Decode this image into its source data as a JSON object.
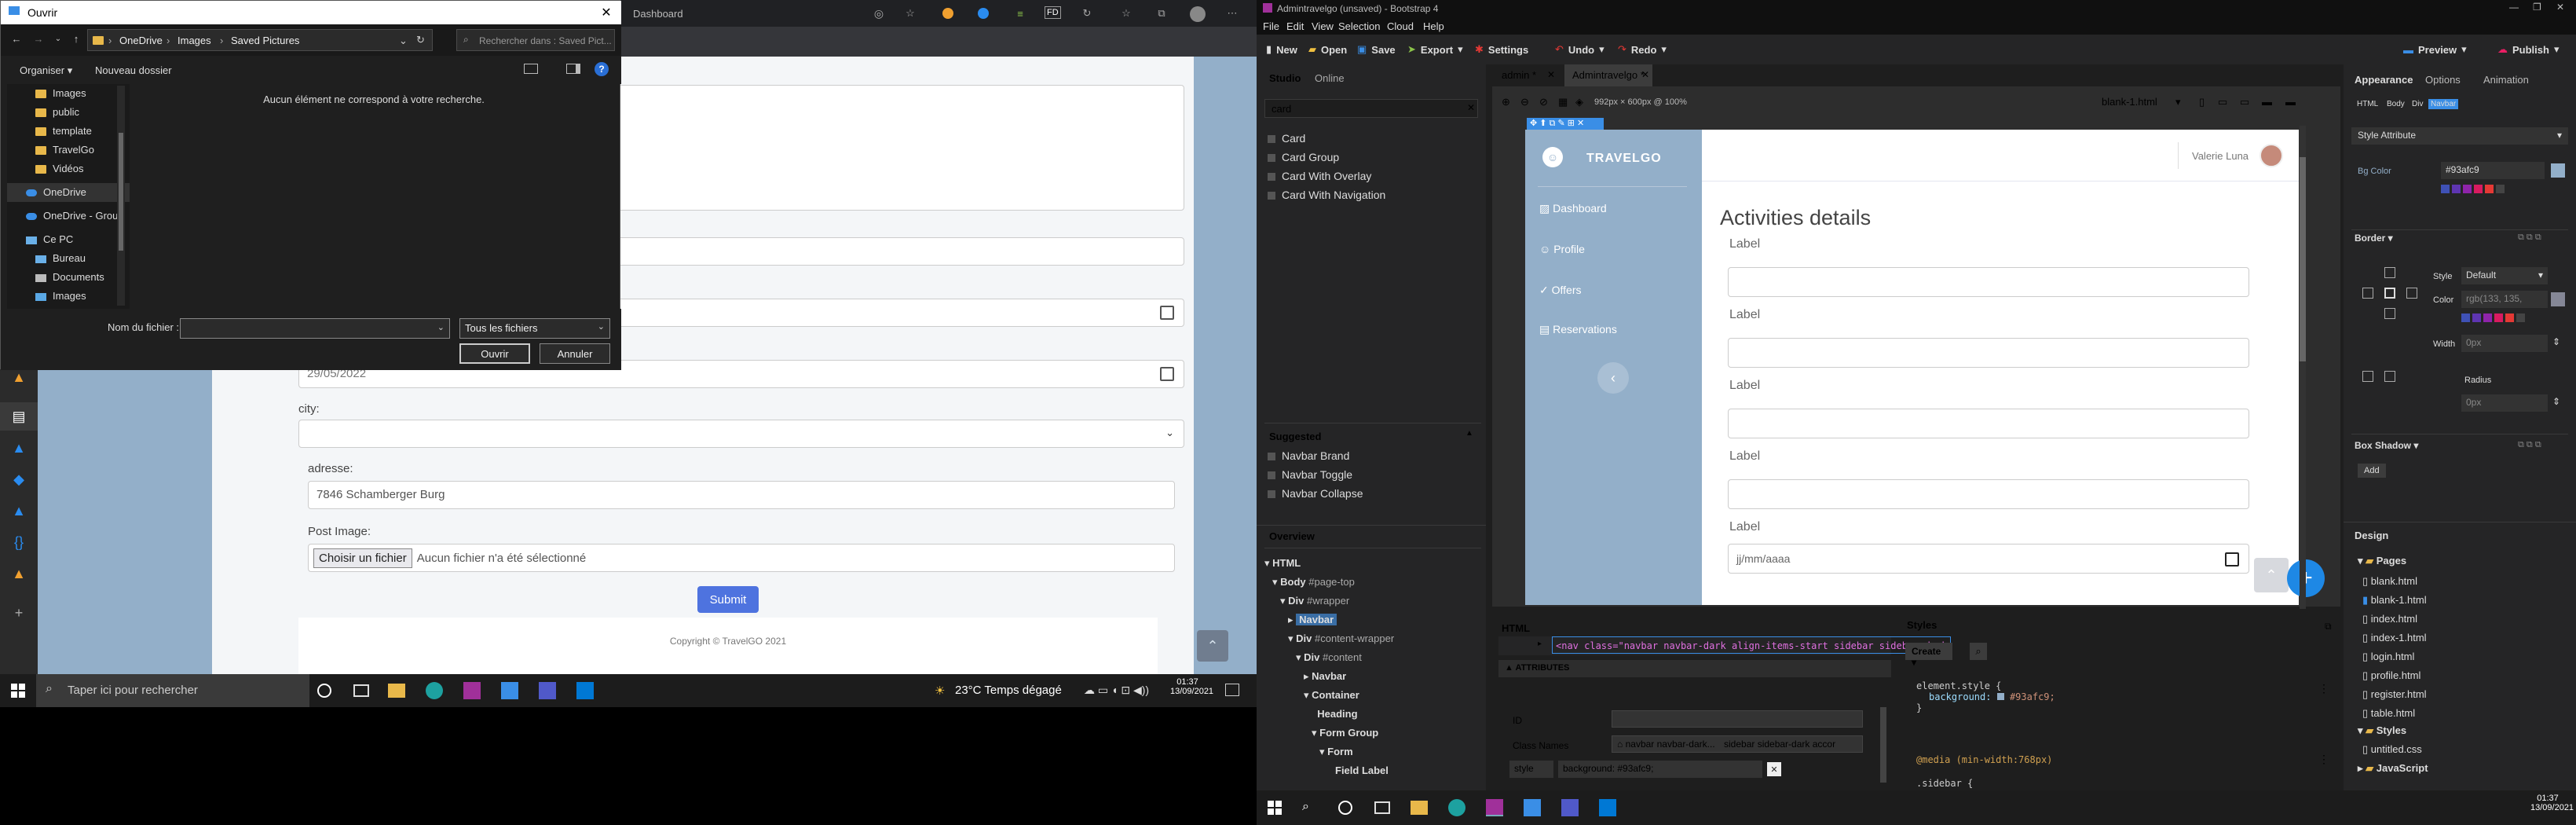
{
  "browser": {
    "title": "Dashboard"
  },
  "form": {
    "city_label": "city:",
    "date_value": "29/05/2022",
    "adresse_label": "adresse:",
    "adresse_value": "7846 Schamberger Burg",
    "post_image_label": "Post Image:",
    "file_button": "Choisir un fichier",
    "file_status": "Aucun fichier n'a été sélectionné",
    "submit": "Submit",
    "footer": "Copyright © TravelGO 2021"
  },
  "dialog": {
    "title": "Ouvrir",
    "path": [
      "OneDrive",
      "Images",
      "Saved Pictures"
    ],
    "search_placeholder": "Rechercher dans : Saved Pict...",
    "organize": "Organiser ▾",
    "new_folder": "Nouveau dossier",
    "empty": "Aucun élément ne correspond à votre recherche.",
    "nav": [
      {
        "label": "Images",
        "kind": "folder"
      },
      {
        "label": "public",
        "kind": "folder"
      },
      {
        "label": "template",
        "kind": "folder"
      },
      {
        "label": "TravelGo",
        "kind": "folder"
      },
      {
        "label": "Vidéos",
        "kind": "folder"
      },
      {
        "label": "OneDrive",
        "kind": "cloud"
      },
      {
        "label": "OneDrive - Group",
        "kind": "cloud"
      },
      {
        "label": "Ce PC",
        "kind": "pc"
      },
      {
        "label": "Bureau",
        "kind": "pc"
      },
      {
        "label": "Documents",
        "kind": "pc"
      },
      {
        "label": "Images",
        "kind": "pc"
      }
    ],
    "filename_label": "Nom du fichier :",
    "filter": "Tous les fichiers",
    "open": "Ouvrir",
    "cancel": "Annuler"
  },
  "taskbar_left": {
    "search": "Taper ici pour rechercher",
    "weather": "23°C  Temps dégagé",
    "time": "01:37",
    "date": "13/09/2021"
  },
  "bootstrap": {
    "title": "Admintravelgo (unsaved) - Bootstrap 4",
    "menu": [
      "File",
      "Edit",
      "View",
      "Selection",
      "Cloud",
      "Help"
    ],
    "toolbar": {
      "new": "New",
      "open": "Open",
      "save": "Save",
      "export": "Export",
      "settings": "Settings",
      "undo": "Undo",
      "redo": "Redo",
      "preview": "Preview",
      "publish": "Publish"
    },
    "left_tabs": [
      "Studio",
      "Online"
    ],
    "search_value": "card",
    "components": [
      "Card",
      "Card Group",
      "Card With Overlay",
      "Card With Navigation"
    ],
    "suggested_title": "Suggested",
    "suggested": [
      "Navbar Brand",
      "Navbar Toggle",
      "Navbar Collapse"
    ],
    "overview_title": "Overview",
    "overview": [
      {
        "t": "HTML",
        "s": "",
        "indent": 0
      },
      {
        "t": "Body",
        "s": "#page-top",
        "indent": 1
      },
      {
        "t": "Div",
        "s": "#wrapper",
        "indent": 2
      },
      {
        "t": "Navbar",
        "s": "",
        "indent": 3
      },
      {
        "t": "Div",
        "s": "#content-wrapper",
        "indent": 3
      },
      {
        "t": "Div",
        "s": "#content",
        "indent": 4
      },
      {
        "t": "Navbar",
        "s": "",
        "indent": 5
      },
      {
        "t": "Container",
        "s": "",
        "indent": 5
      },
      {
        "t": "Heading",
        "s": "",
        "indent": 6
      },
      {
        "t": "Form Group",
        "s": "",
        "indent": 6
      },
      {
        "t": "Form",
        "s": "",
        "indent": 7
      },
      {
        "t": "Field Label",
        "s": "",
        "indent": 8
      }
    ],
    "doc_tabs": [
      "admin *",
      "Admintravelgo *"
    ],
    "zoom": "992px × 600px @ 100%",
    "page_select": "blank-1.html",
    "canvas": {
      "brand": "TRAVELGO",
      "user": "Valerie Luna",
      "nav": [
        "Dashboard",
        "Profile",
        "Offers",
        "Reservations"
      ],
      "heading": "Activities details",
      "labels": [
        "Label",
        "Label",
        "Label",
        "Label",
        "Label"
      ],
      "date_placeholder": "jj/mm/aaaa"
    },
    "html_panel": {
      "tab": "HTML",
      "code": "<nav class=\"navbar navbar-dark align-items-start sidebar sidebar-dark accor",
      "attributes": "ATTRIBUTES",
      "id_label": "ID",
      "class_label": "Class Names",
      "class_value": "navbar navbar-dark...",
      "class_value2": "sidebar sidebar-dark accor",
      "style_label": "style",
      "style_value": "background: #93afc9;"
    },
    "styles_panel": {
      "tab": "Styles",
      "create": "Create",
      "rule1": "element.style {",
      "prop": "background:",
      "val": "#93afc9;",
      "close": "}",
      "media": "@media (min-width:768px)",
      "sel2": ".sidebar {"
    },
    "right": {
      "tabs": [
        "Appearance",
        "Options",
        "Animation"
      ],
      "subtabs": [
        "HTML",
        "Body",
        "Div",
        "Navbar"
      ],
      "style_attr": "Style Attribute",
      "bg_label": "Bg Color",
      "bg_value": "#93afc9",
      "border": "Border",
      "style_label": "Style",
      "style_value": "Default",
      "color_label": "Color",
      "color_value": "rgb(133, 135,",
      "width_label": "Width",
      "width_value": "0px",
      "radius_label": "Radius",
      "radius_value": "0px",
      "box_shadow": "Box Shadow",
      "add": "Add",
      "design": "Design",
      "pages_title": "Pages",
      "pages": [
        "blank.html",
        "blank-1.html",
        "index.html",
        "index-1.html",
        "login.html",
        "profile.html",
        "register.html",
        "table.html"
      ],
      "styles_title": "Styles",
      "styles_file": "untitled.css",
      "js_title": "JavaScript"
    },
    "taskbar": {
      "time": "01:37",
      "date": "13/09/2021"
    }
  },
  "colors": {
    "sidebar": "#93afc9",
    "accent": "#4e73df",
    "swatches": [
      "#3f51b5",
      "#5e35b1",
      "#8e24aa",
      "#d81b60",
      "#e53935",
      "#444444"
    ]
  }
}
